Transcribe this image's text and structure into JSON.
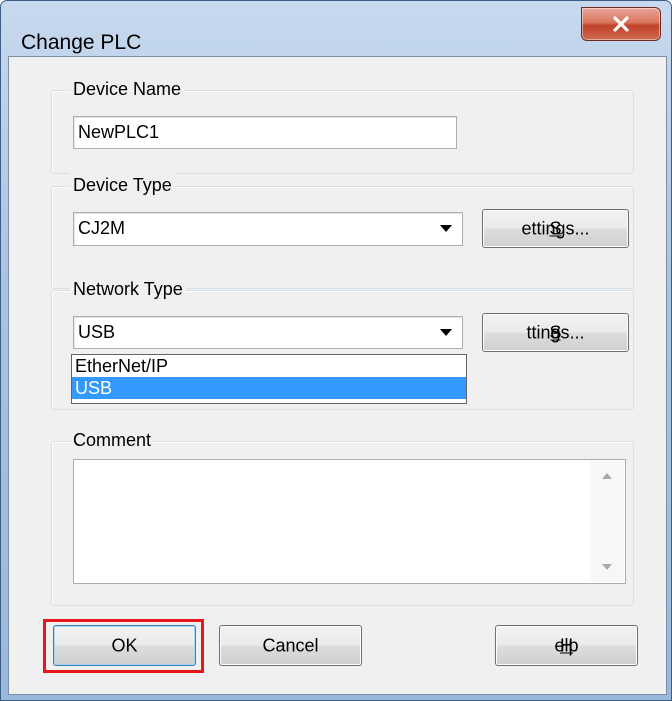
{
  "window": {
    "title": "Change PLC",
    "close_glyph": "close-icon"
  },
  "device_name": {
    "legend": "Device Name",
    "value": "NewPLC1"
  },
  "device_type": {
    "legend": "Device Type",
    "value": "CJ2M",
    "settings_label_prefix": "",
    "settings_label_accel": "S",
    "settings_label_rest": "ettings..."
  },
  "network_type": {
    "legend": "Network Type",
    "value": "USB",
    "settings_label_prefix": "S",
    "settings_label_accel": "e",
    "settings_label_rest": "ttings...",
    "options": [
      "EtherNet/IP",
      "USB"
    ],
    "selected_option": "USB"
  },
  "comment": {
    "legend": "Comment",
    "value": ""
  },
  "buttons": {
    "ok": "OK",
    "cancel": "Cancel",
    "help_accel": "H",
    "help_rest": "elp"
  },
  "colors": {
    "highlight": "#e5171b",
    "selection": "#3399ff"
  }
}
